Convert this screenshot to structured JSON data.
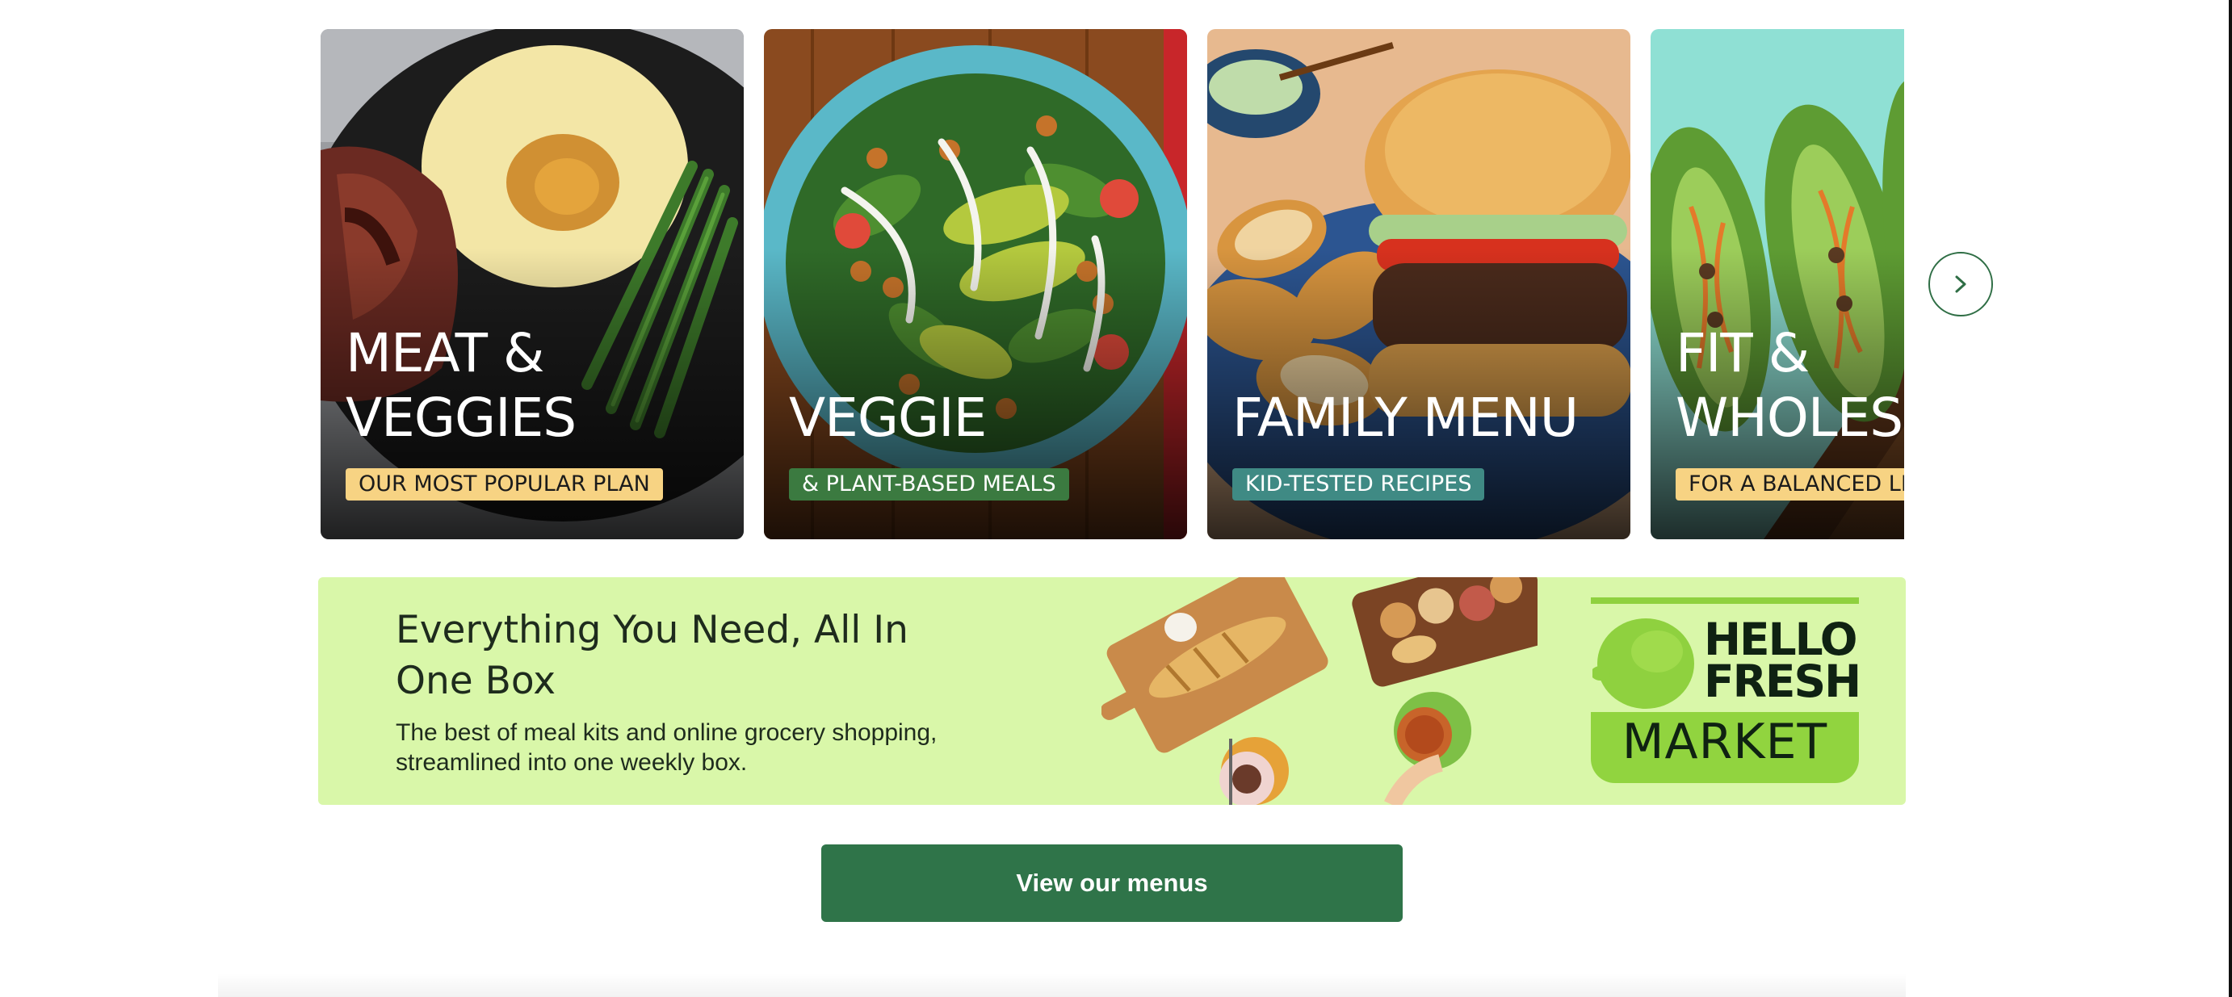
{
  "carousel": {
    "cards": [
      {
        "title": "MEAT &\nVEGGIES",
        "tag": "OUR MOST POPULAR PLAN",
        "tag_bg": "#f7d383",
        "tag_color": "#1b1b1b"
      },
      {
        "title": "VEGGIE",
        "tag": "& PLANT-BASED MEALS",
        "tag_bg": "#3b7a40",
        "tag_color": "#ffffff"
      },
      {
        "title": "FAMILY MENU",
        "tag": "KID-TESTED RECIPES",
        "tag_bg": "#3f8a84",
        "tag_color": "#ffffff"
      },
      {
        "title": "FIT &\nWHOLESOME",
        "tag": "FOR A BALANCED LIFE",
        "tag_bg": "#f7d383",
        "tag_color": "#1b1b1b"
      }
    ],
    "next_icon": "chevron-right-icon"
  },
  "market_banner": {
    "heading": "Everything You Need, All In One Box",
    "subtext": "The best of meal kits and online grocery shopping, streamlined into one weekly box.",
    "logo_hello_fresh": "HELLO\nFRESH",
    "logo_market": "MARKET",
    "background": "#d9f7a9"
  },
  "cta": {
    "label": "View our menus",
    "color": "#2f7449"
  }
}
